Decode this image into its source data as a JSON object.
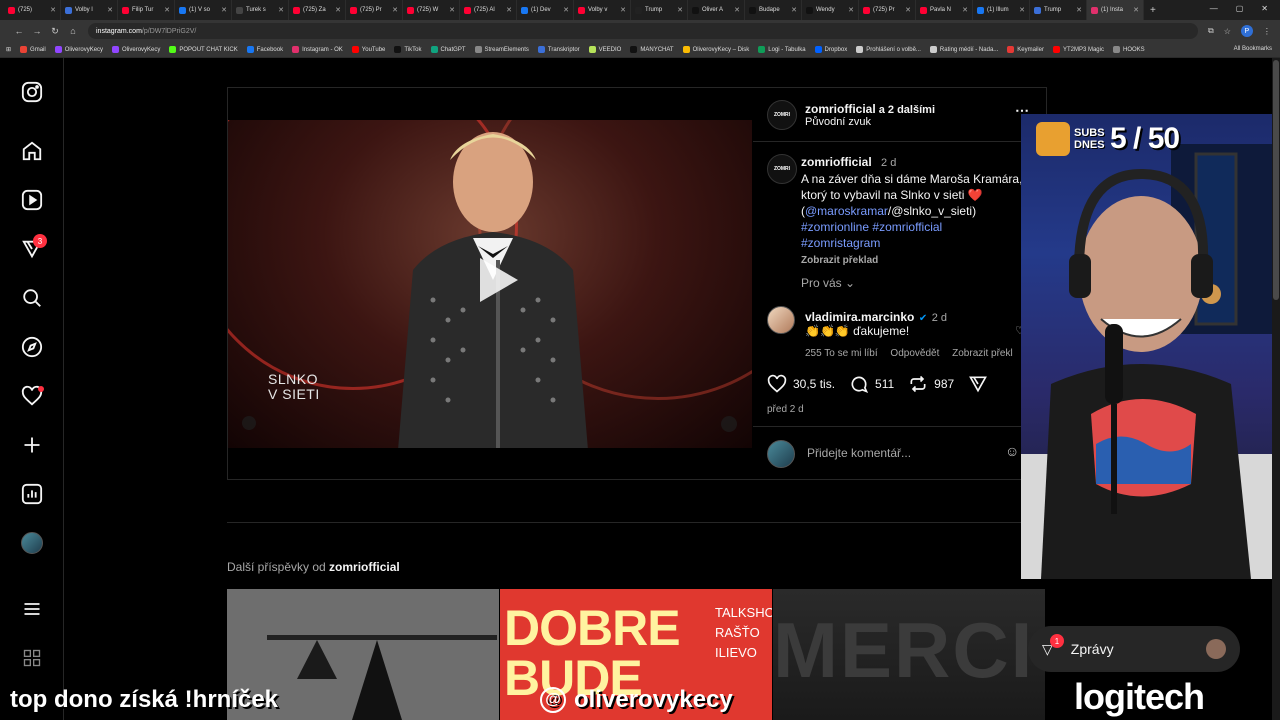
{
  "browser": {
    "tabs": [
      {
        "title": "(725)",
        "color": "#ff0033"
      },
      {
        "title": "Volby l",
        "color": "#3b6fd8"
      },
      {
        "title": "Filip Tur",
        "color": "#ff0033"
      },
      {
        "title": "(1) V so",
        "color": "#1877f2"
      },
      {
        "title": "Turek s",
        "color": "#444444"
      },
      {
        "title": "(725) Za",
        "color": "#ff0033"
      },
      {
        "title": "(725) Pr",
        "color": "#ff0033"
      },
      {
        "title": "(725) W",
        "color": "#ff0033"
      },
      {
        "title": "(725) Al",
        "color": "#ff0033"
      },
      {
        "title": "(1) Dev",
        "color": "#1877f2"
      },
      {
        "title": "Volby v",
        "color": "#ff0033"
      },
      {
        "title": "Trump",
        "color": "#222222"
      },
      {
        "title": "Oliver A",
        "color": "#111111"
      },
      {
        "title": "Budape",
        "color": "#111111"
      },
      {
        "title": "Wendy",
        "color": "#111111"
      },
      {
        "title": "(725) Pr",
        "color": "#ff0033"
      },
      {
        "title": "Pavla N",
        "color": "#ff0033"
      },
      {
        "title": "(1) Illum",
        "color": "#1877f2"
      },
      {
        "title": "Trump",
        "color": "#3b6fd8"
      },
      {
        "title": "(1) Insta",
        "color": "#e1306c",
        "active": true
      }
    ],
    "new_tab": "+",
    "url_host": "instagram.com",
    "url_path": "/p/DW7lDPriG2V/",
    "bookmarks": [
      {
        "label": "Gmail",
        "color": "#ea4335"
      },
      {
        "label": "OliverovyKecy",
        "color": "#9146ff"
      },
      {
        "label": "OliverovyKecy",
        "color": "#9146ff"
      },
      {
        "label": "POPOUT CHAT KICK",
        "color": "#53fc18"
      },
      {
        "label": "Facebook",
        "color": "#1877f2"
      },
      {
        "label": "Instagram - OK",
        "color": "#e1306c"
      },
      {
        "label": "YouTube",
        "color": "#ff0000"
      },
      {
        "label": "TikTok",
        "color": "#111111"
      },
      {
        "label": "ChatGPT",
        "color": "#10a37f"
      },
      {
        "label": "StreamElements",
        "color": "#888888"
      },
      {
        "label": "Transkriptor",
        "color": "#3b6fd8"
      },
      {
        "label": "VEEDIO",
        "color": "#b6e35a"
      },
      {
        "label": "MANYCHAT",
        "color": "#111111"
      },
      {
        "label": "OliverovyKecy – Disk",
        "color": "#fbbc04"
      },
      {
        "label": "Logi - Tabulka",
        "color": "#0f9d58"
      },
      {
        "label": "Dropbox",
        "color": "#0061ff"
      },
      {
        "label": "Prohlášení o volbě...",
        "color": "#cccccc"
      },
      {
        "label": "Rating médií - Nada...",
        "color": "#cccccc"
      },
      {
        "label": "Keymailer",
        "color": "#e53935"
      },
      {
        "label": "YT2MP3 Magic",
        "color": "#ff0000"
      },
      {
        "label": "HOOKS",
        "color": "#888888"
      }
    ],
    "all_bookmarks": "All Bookmarks"
  },
  "sidebar": {
    "notifications_count": "3"
  },
  "post": {
    "header_user": "zomriofficial",
    "header_coauthors": " a 2 dalšími",
    "header_audio": "Původní zvuk",
    "avatar_text": "ZOMRI",
    "video_overlay": {
      "line1": "SLNKO",
      "line2": "V SIETI"
    },
    "caption": {
      "user": "zomriofficial",
      "time": "2 d",
      "text1": "A na záver dňa si dáme Maroša Kramára, ktorý to vybavil na Slnko v sieti ",
      "heart": "❤️",
      "text2": "(",
      "mention1": "@maroskramar",
      "text3": "/@slnko_v_sieti)",
      "hashtag1": "#zomrionline",
      "hashtag2": "#zomriofficial",
      "hashtag3": "#zomristagram",
      "translate": "Zobrazit překlad"
    },
    "for_you": "Pro vás",
    "comment": {
      "user": "vladimira.marcinko",
      "time": "2 d",
      "text": "👏👏👏 ďakujeme!",
      "likes": "255 To se mi líbí",
      "reply": "Odpovědět",
      "translate": "Zobrazit překl"
    },
    "likes": "30,5 tis.",
    "comments": "511",
    "reposts": "987",
    "ago": "před 2 d",
    "comment_placeholder": "Přidejte komentář..."
  },
  "more_posts": {
    "label": "Další příspěvky od ",
    "user": "zomriofficial",
    "thumb2_big": "DOBRE BUDE",
    "thumb2_talk": "TALKSHO RAŠŤO ILIEVO",
    "thumb3_big": "MERCI"
  },
  "messages": {
    "label": "Zprávy",
    "badge": "1"
  },
  "overlay": {
    "subs_label": "SUBS DNES",
    "subs_count": "5 / 50",
    "bottom_left": "top dono získá !hrníček",
    "bottom_mid": "oliverovykecy",
    "bottom_right": "logitech"
  },
  "colors": {
    "accent_blue": "#0095f6",
    "link": "#7a9cff",
    "badge_red": "#ff3040"
  }
}
